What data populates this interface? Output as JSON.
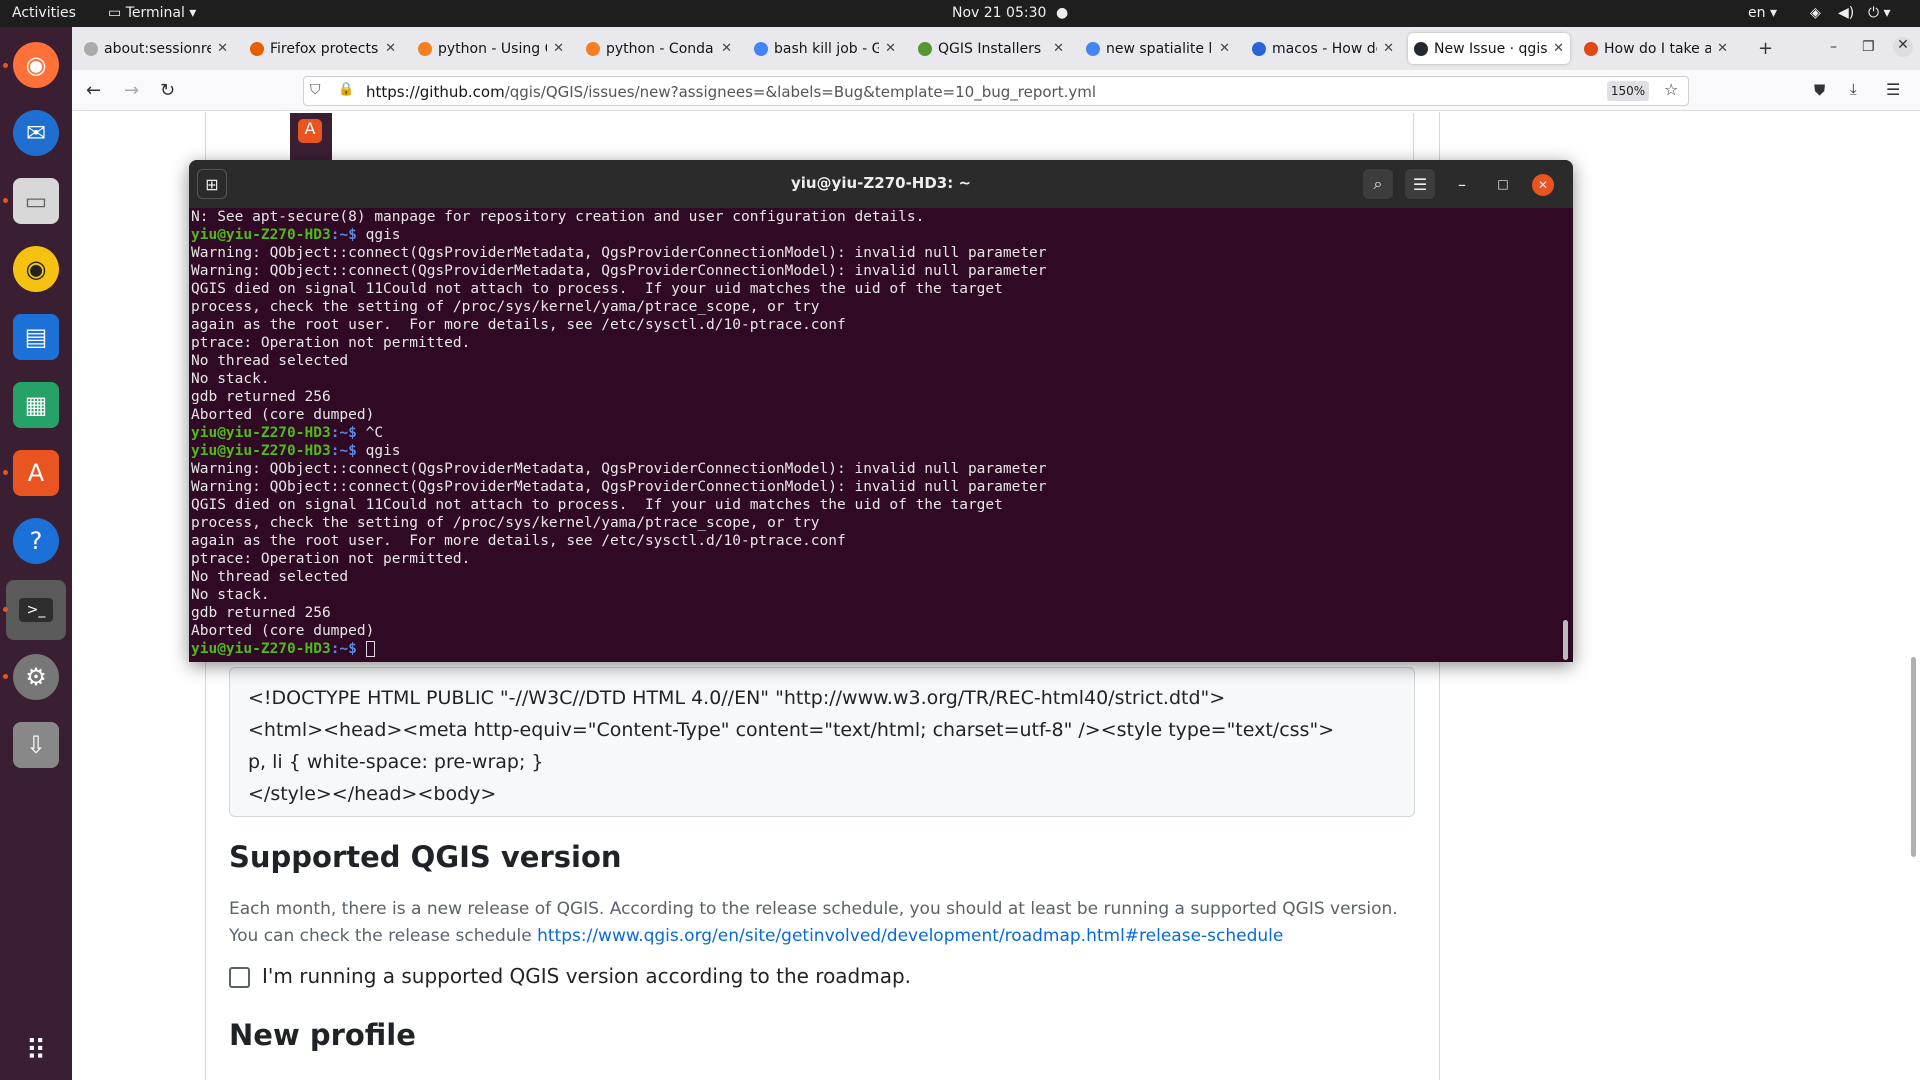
{
  "topbar": {
    "activities": "Activities",
    "app": "Terminal",
    "datetime": "Nov 21  05:30",
    "lang": "en"
  },
  "tabs": [
    {
      "label": "about:sessionresto",
      "favicon": "blank-icon",
      "color": "#aaaaaa"
    },
    {
      "label": "Firefox protects",
      "favicon": "firefox-icon",
      "color": "#e66000"
    },
    {
      "label": "python - Using Q",
      "favicon": "stackoverflow-icon",
      "color": "#f48024"
    },
    {
      "label": "python - Conda",
      "favicon": "stackoverflow-icon",
      "color": "#f48024"
    },
    {
      "label": "bash kill job - Go",
      "favicon": "google-icon",
      "color": "#4285f4"
    },
    {
      "label": "QGIS Installers",
      "favicon": "qgis-icon",
      "color": "#589632"
    },
    {
      "label": "new spatialite la",
      "favicon": "google-icon",
      "color": "#4285f4"
    },
    {
      "label": "macos - How do",
      "favicon": "stackexchange-icon",
      "color": "#2b63d6"
    },
    {
      "label": "New Issue · qgis/",
      "favicon": "github-icon",
      "color": "#24292f"
    },
    {
      "label": "How do I take a",
      "favicon": "askubuntu-icon",
      "color": "#dd4814"
    }
  ],
  "nav": {
    "url_domain": "https://github.com",
    "url_path": "/qgis/QGIS/issues/new?assignees=&labels=Bug&template=10_bug_report.yml",
    "zoom": "150%"
  },
  "terminal": {
    "title": "yiu@yiu-Z270-HD3: ~",
    "prompt_user": "yiu@yiu-Z270-HD3",
    "prompt_path": ":~$",
    "lines": [
      {
        "type": "out",
        "text": "N: See apt-secure(8) manpage for repository creation and user configuration details."
      },
      {
        "type": "prompt",
        "text": " qgis"
      },
      {
        "type": "out",
        "text": "Warning: QObject::connect(QgsProviderMetadata, QgsProviderConnectionModel): invalid null parameter"
      },
      {
        "type": "out",
        "text": "Warning: QObject::connect(QgsProviderMetadata, QgsProviderConnectionModel): invalid null parameter"
      },
      {
        "type": "out",
        "text": "QGIS died on signal 11Could not attach to process.  If your uid matches the uid of the target"
      },
      {
        "type": "out",
        "text": "process, check the setting of /proc/sys/kernel/yama/ptrace_scope, or try"
      },
      {
        "type": "out",
        "text": "again as the root user.  For more details, see /etc/sysctl.d/10-ptrace.conf"
      },
      {
        "type": "out",
        "text": "ptrace: Operation not permitted."
      },
      {
        "type": "out",
        "text": "No thread selected"
      },
      {
        "type": "out",
        "text": "No stack."
      },
      {
        "type": "out",
        "text": "gdb returned 256"
      },
      {
        "type": "out",
        "text": "Aborted (core dumped)"
      },
      {
        "type": "prompt",
        "text": " ^C"
      },
      {
        "type": "prompt",
        "text": " qgis"
      },
      {
        "type": "out",
        "text": "Warning: QObject::connect(QgsProviderMetadata, QgsProviderConnectionModel): invalid null parameter"
      },
      {
        "type": "out",
        "text": "Warning: QObject::connect(QgsProviderMetadata, QgsProviderConnectionModel): invalid null parameter"
      },
      {
        "type": "out",
        "text": "QGIS died on signal 11Could not attach to process.  If your uid matches the uid of the target"
      },
      {
        "type": "out",
        "text": "process, check the setting of /proc/sys/kernel/yama/ptrace_scope, or try"
      },
      {
        "type": "out",
        "text": "again as the root user.  For more details, see /etc/sysctl.d/10-ptrace.conf"
      },
      {
        "type": "out",
        "text": "ptrace: Operation not permitted."
      },
      {
        "type": "out",
        "text": "No thread selected"
      },
      {
        "type": "out",
        "text": "No stack."
      },
      {
        "type": "out",
        "text": "gdb returned 256"
      },
      {
        "type": "out",
        "text": "Aborted (core dumped)"
      },
      {
        "type": "prompt",
        "text": " ",
        "cursor": true
      }
    ]
  },
  "page": {
    "code_lines": "<!DOCTYPE HTML PUBLIC \"-//W3C//DTD HTML 4.0//EN\" \"http://www.w3.org/TR/REC-html40/strict.dtd\">\n<html><head><meta http-equiv=\"Content-Type\" content=\"text/html; charset=utf-8\" /><style type=\"text/css\">\np, li { white-space: pre-wrap; }\n</style></head><body>",
    "section1_title": "Supported QGIS version",
    "section1_text1": "Each month, there is a new release of QGIS. According to the release schedule, you should at least be running a supported QGIS version.",
    "section1_text2": "You can check the release schedule ",
    "section1_link": "https://www.qgis.org/en/site/getinvolved/development/roadmap.html#release-schedule",
    "checkbox_label": "I'm running a supported QGIS version according to the roadmap.",
    "section2_title": "New profile"
  }
}
